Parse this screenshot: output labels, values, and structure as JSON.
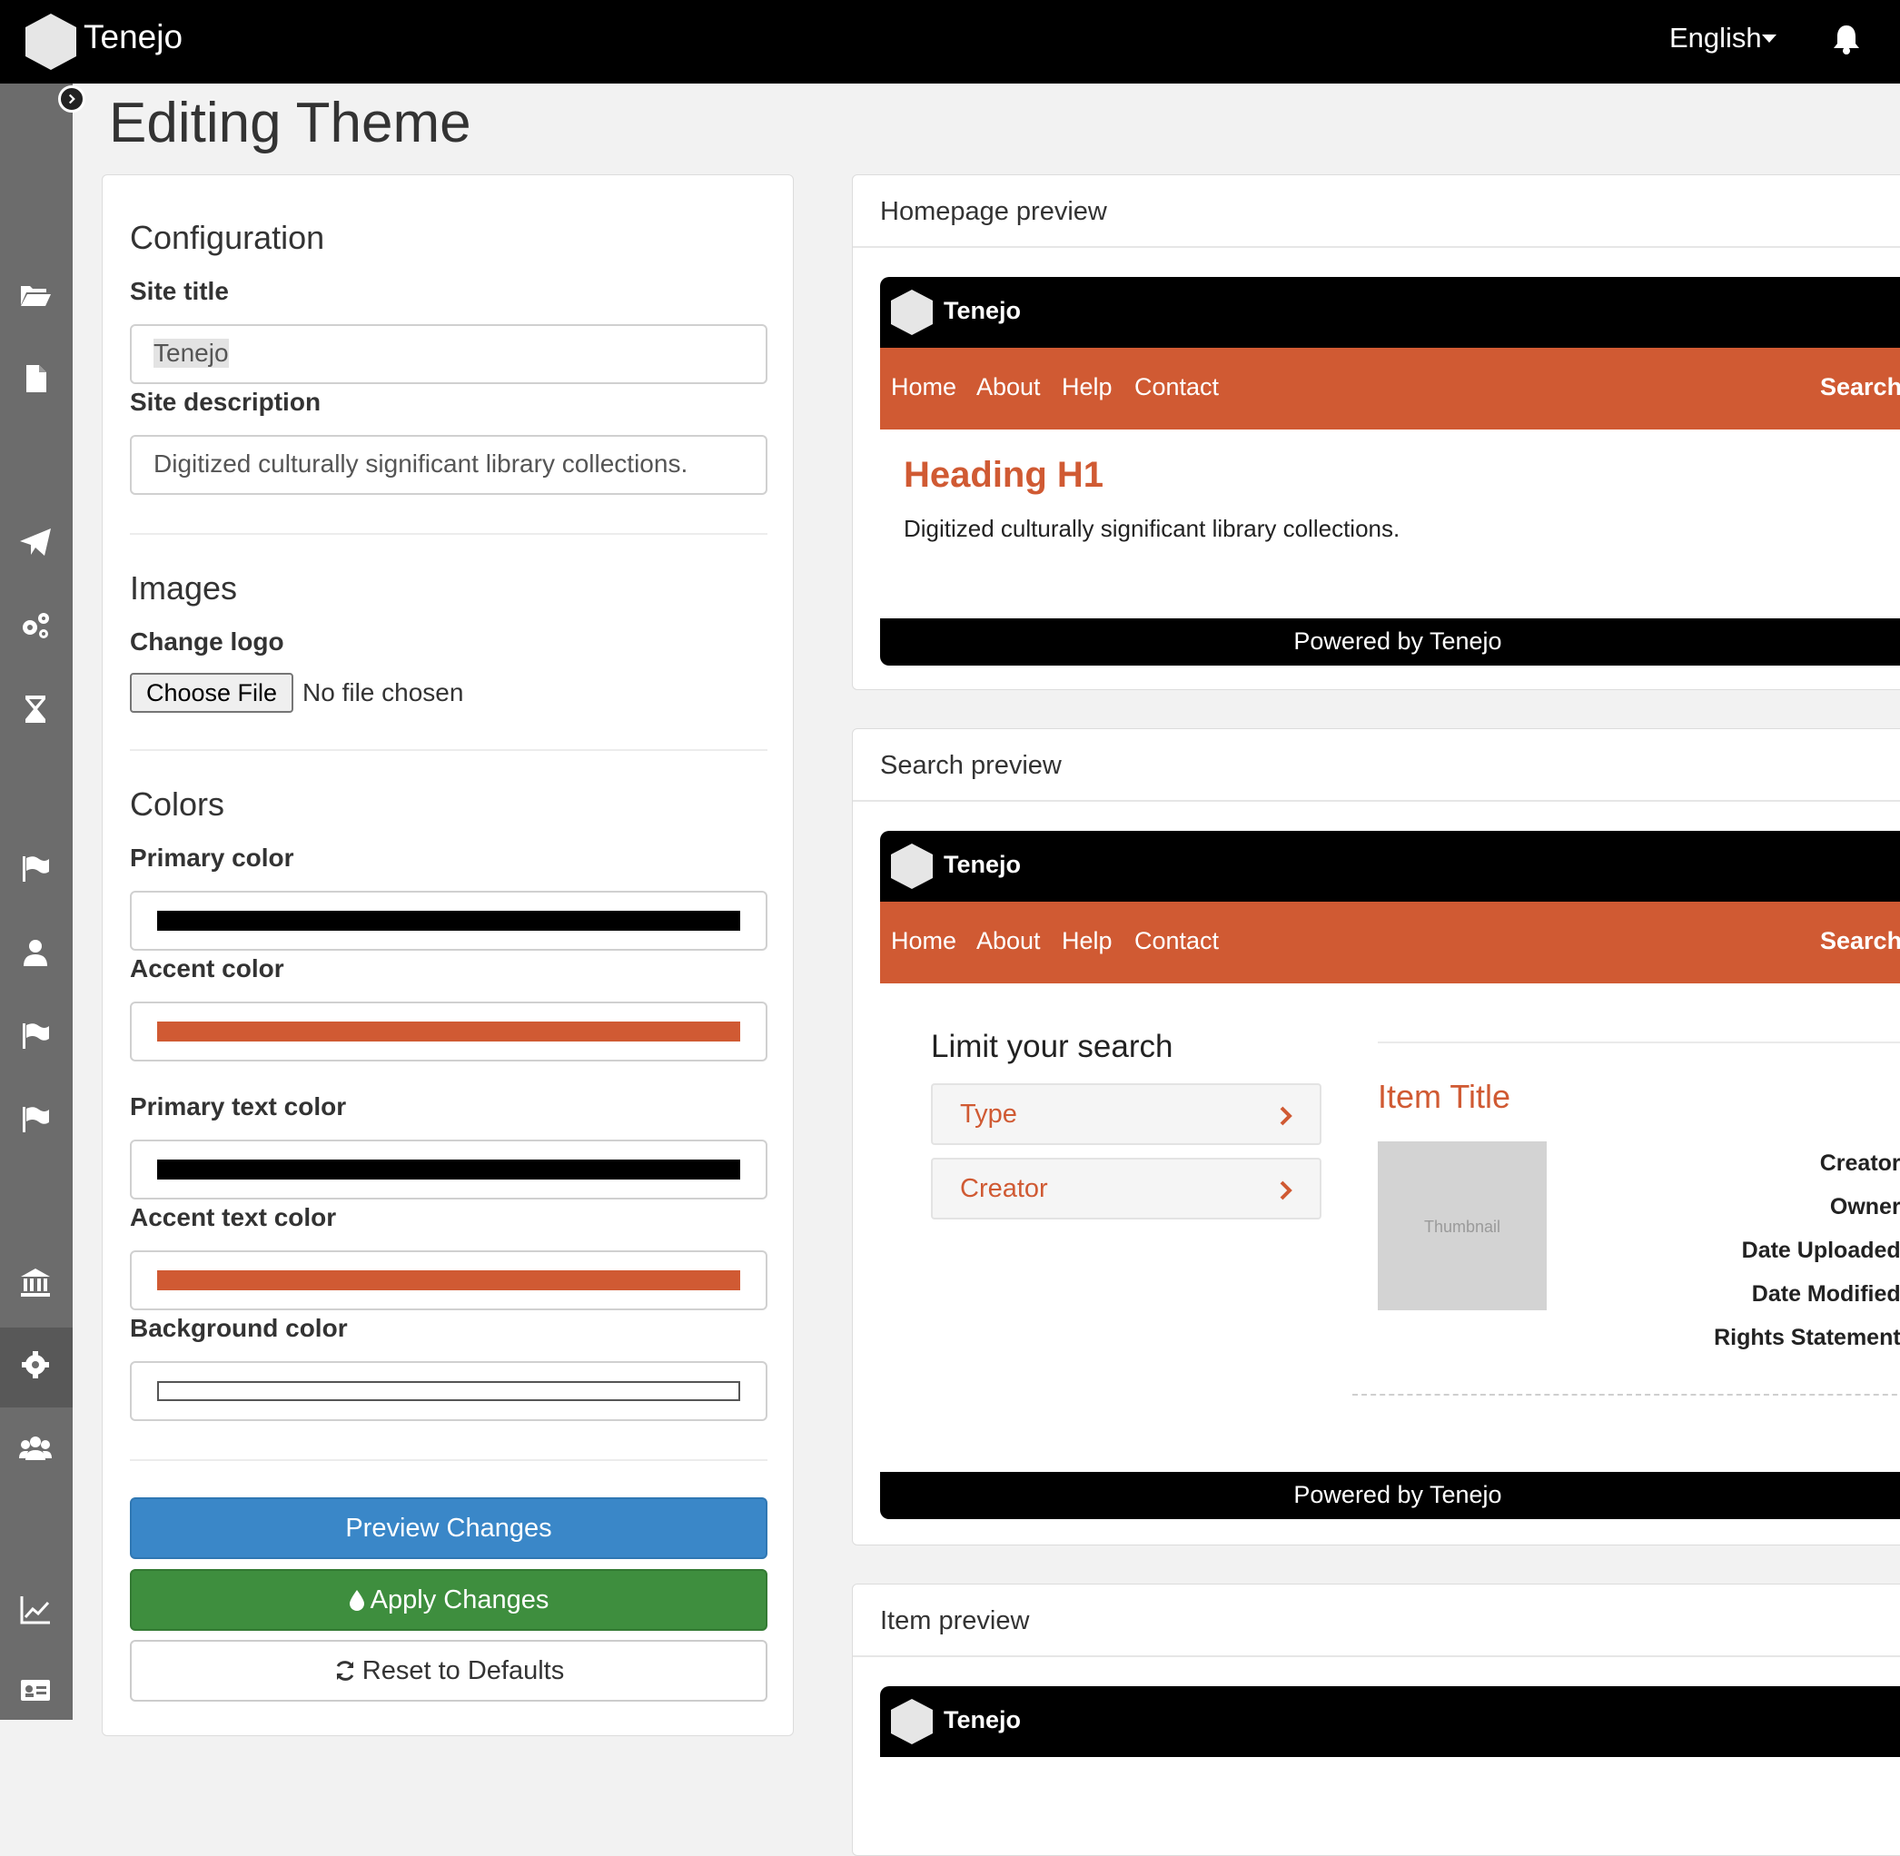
{
  "topbar": {
    "brand": "Tenejo",
    "language": "English"
  },
  "page": {
    "title": "Editing Theme"
  },
  "config": {
    "heading": "Configuration",
    "site_title_label": "Site title",
    "site_title_value": "Tenejo",
    "site_description_label": "Site description",
    "site_description_value": "Digitized culturally significant library collections."
  },
  "images": {
    "heading": "Images",
    "change_logo_label": "Change logo",
    "choose_file_label": "Choose File",
    "no_file_text": "No file chosen"
  },
  "colors": {
    "heading": "Colors",
    "primary_label": "Primary color",
    "primary_value": "#000000",
    "accent_label": "Accent color",
    "accent_value": "#d05a33",
    "primary_text_label": "Primary text color",
    "primary_text_value": "#000000",
    "accent_text_label": "Accent text color",
    "accent_text_value": "#d05a33",
    "background_label": "Background color",
    "background_value": "#ffffff"
  },
  "actions": {
    "preview": "Preview Changes",
    "apply": "Apply Changes",
    "reset": "Reset to Defaults"
  },
  "previews": {
    "homepage_heading": "Homepage preview",
    "search_heading": "Search preview",
    "item_heading": "Item preview",
    "brand": "Tenejo",
    "nav": [
      "Home",
      "About",
      "Help",
      "Contact"
    ],
    "search_link": "Search",
    "footer": "Powered by Tenejo",
    "heading_h1": "Heading H1",
    "description": "Digitized culturally significant library collections."
  },
  "search_preview": {
    "limit_heading": "Limit your search",
    "facets": [
      "Type",
      "Creator"
    ],
    "item_title": "Item Title",
    "thumbnail": "Thumbnail",
    "meta_labels": [
      "Creator:",
      "Owner:",
      "Date Uploaded:",
      "Date Modified:",
      "Rights Statement:"
    ]
  }
}
